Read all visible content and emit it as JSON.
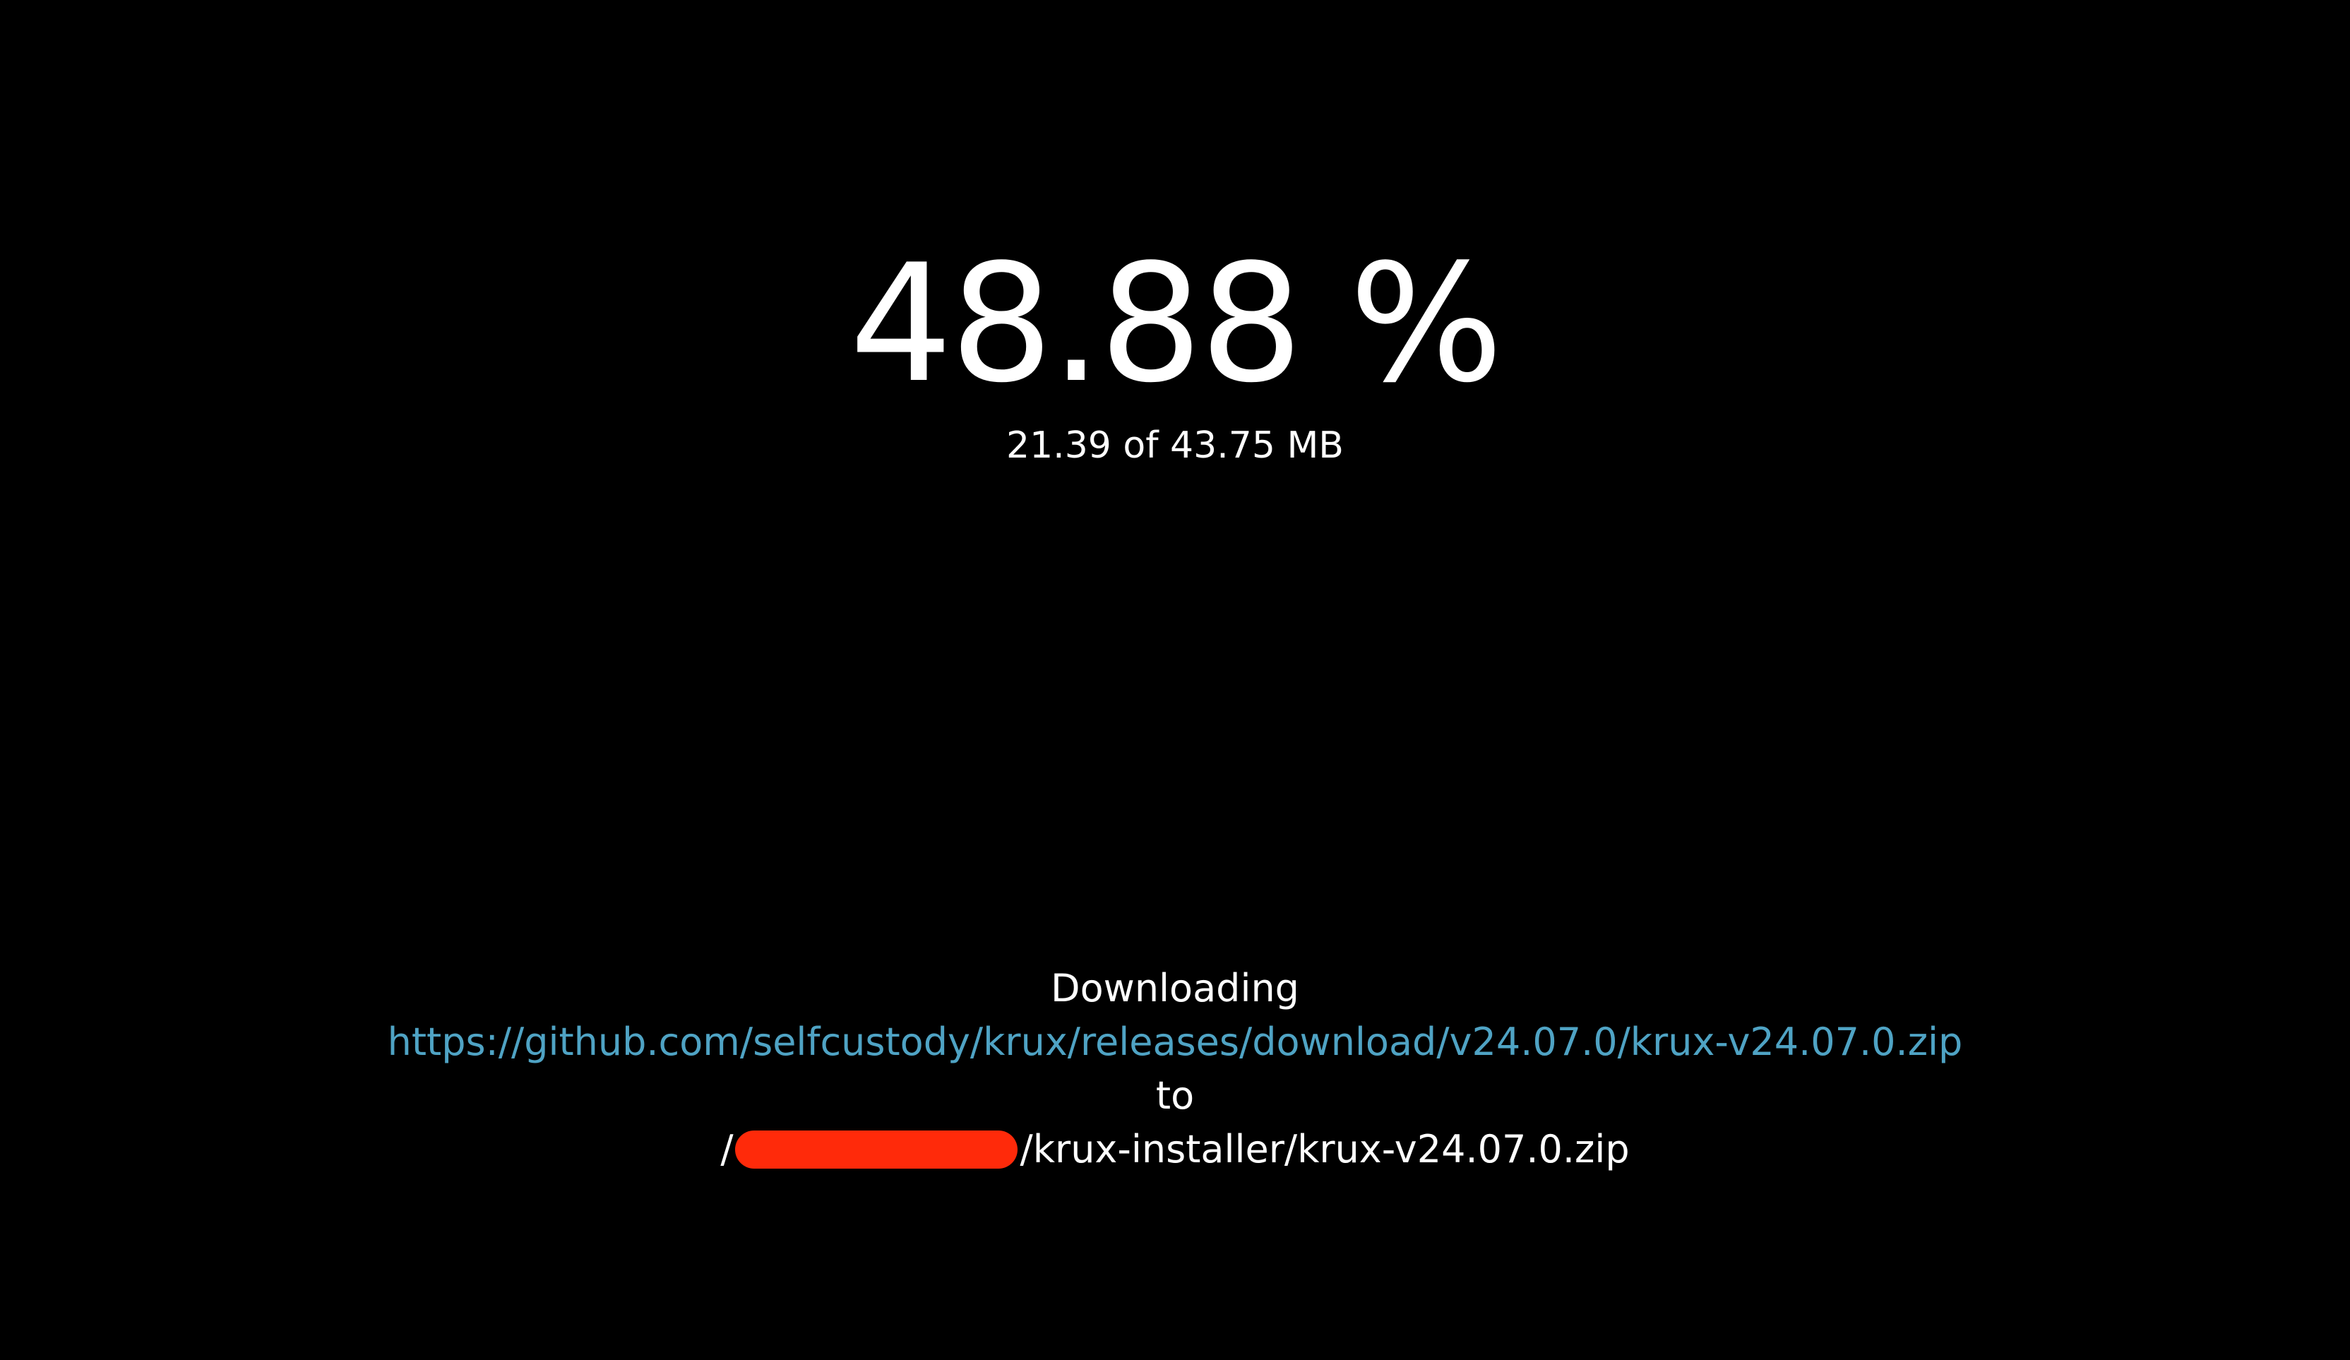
{
  "progress": {
    "percent_text": "48.88 %",
    "percent_value": 48.88,
    "size_text": "21.39 of 43.75 MB"
  },
  "download": {
    "status_label": "Downloading",
    "url": "https://github.com/selfcustody/krux/releases/download/v24.07.0/krux-v24.07.0.zip",
    "to_label": "to",
    "dest_prefix": "/",
    "dest_suffix": "/krux-installer/krux-v24.07.0.zip"
  },
  "colors": {
    "background": "#000000",
    "text": "#ffffff",
    "link": "#4fa3c4",
    "redaction": "#ff2a0a"
  }
}
